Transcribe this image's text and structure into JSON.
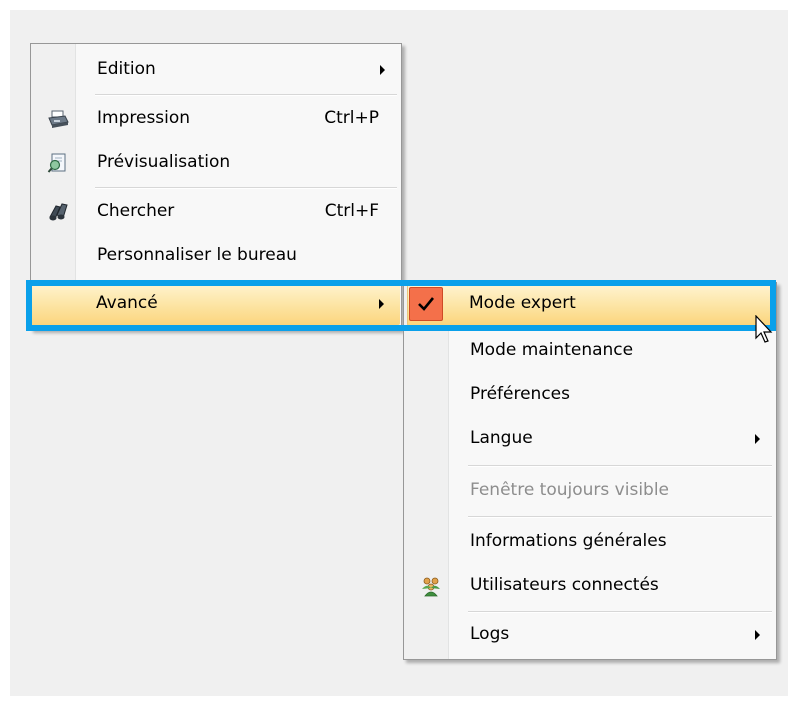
{
  "main_menu": {
    "items": [
      {
        "label": "Edition",
        "has_submenu": true
      },
      {
        "label": "Impression",
        "shortcut": "Ctrl+P",
        "icon": "printer-icon"
      },
      {
        "label": "Prévisualisation",
        "icon": "print-preview-icon"
      },
      {
        "label": "Chercher",
        "shortcut": "Ctrl+F",
        "icon": "binoculars-icon"
      },
      {
        "label": "Personnaliser le bureau"
      },
      {
        "label": "Avancé",
        "has_submenu": true,
        "highlighted": true
      }
    ]
  },
  "submenu": {
    "items": [
      {
        "label": "Mode expert",
        "checked": true,
        "highlighted": true
      },
      {
        "label": "Mode maintenance"
      },
      {
        "label": "Préférences"
      },
      {
        "label": "Langue",
        "has_submenu": true
      },
      {
        "label": "Fenêtre toujours visible",
        "disabled": true
      },
      {
        "label": "Informations générales"
      },
      {
        "label": "Utilisateurs connectés",
        "icon": "users-icon"
      },
      {
        "label": "Logs",
        "has_submenu": true
      }
    ]
  },
  "colors": {
    "focus_frame": "#0aa0ea",
    "highlight": "#fbd57d",
    "check_box": "#f4704a"
  }
}
